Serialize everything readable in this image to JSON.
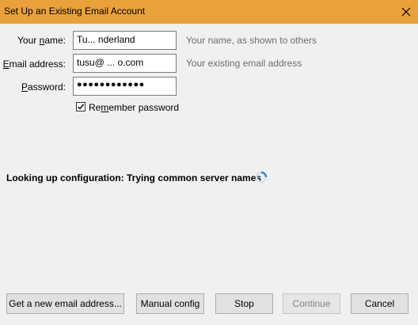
{
  "window": {
    "title": "Set Up an Existing Email Account"
  },
  "form": {
    "name": {
      "label_underlined": "Your ",
      "label_key": "n",
      "label_rest": "ame:",
      "value": "Tu... nderland",
      "hint": "Your name, as shown to others"
    },
    "email": {
      "label_key": "E",
      "label_rest": "mail address:",
      "value": "tusu@ ... o.com",
      "hint": "Your existing email address"
    },
    "password": {
      "label_key": "P",
      "label_rest": "assword:",
      "value": "●●●●●●●●●●●●"
    },
    "remember": {
      "label_key": "m",
      "label_pre": "Re",
      "label_rest": "ember password",
      "checked": true
    }
  },
  "status": {
    "text": "Looking up configuration: Trying common server names"
  },
  "buttons": {
    "new_email": "Get a new email address...",
    "manual": "Manual config",
    "stop": "Stop",
    "continue": "Continue",
    "cancel": "Cancel"
  }
}
